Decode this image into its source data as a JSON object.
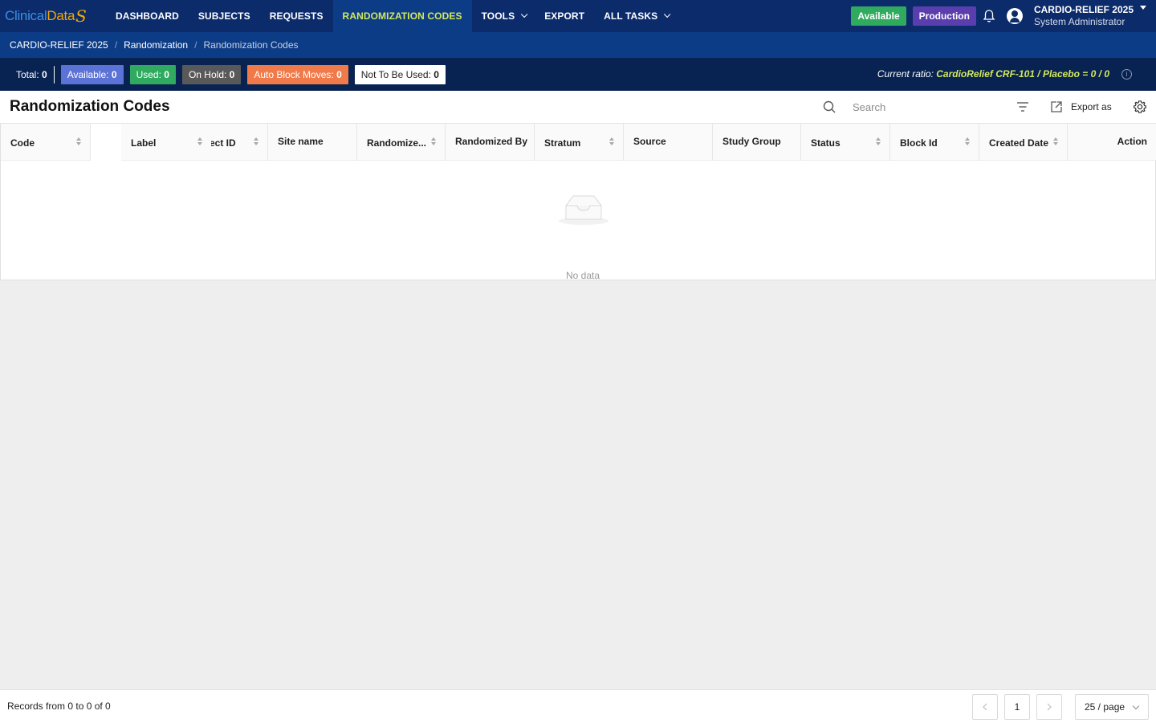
{
  "brand": {
    "part1": "Clinical",
    "part2": "Data",
    "mark": "S"
  },
  "nav": {
    "items": [
      {
        "label": "DASHBOARD"
      },
      {
        "label": "SUBJECTS"
      },
      {
        "label": "REQUESTS"
      },
      {
        "label": "RANDOMIZATION CODES",
        "active": true
      },
      {
        "label": "TOOLS",
        "dropdown": true
      },
      {
        "label": "EXPORT"
      },
      {
        "label": "ALL TASKS",
        "dropdown": true
      }
    ],
    "status_badge": "Available",
    "env_badge": "Production",
    "study_name": "CARDIO-RELIEF 2025",
    "user_role": "System Administrator"
  },
  "breadcrumb": [
    "CARDIO-RELIEF 2025",
    "Randomization",
    "Randomization Codes"
  ],
  "stats": {
    "total_label": "Total:",
    "total_value": "0",
    "available_label": "Available:",
    "available_value": "0",
    "used_label": "Used:",
    "used_value": "0",
    "hold_label": "On Hold:",
    "hold_value": "0",
    "auto_label": "Auto Block Moves:",
    "auto_value": "0",
    "notuse_label": "Not To Be Used:",
    "notuse_value": "0",
    "ratio_label": "Current ratio:",
    "ratio_value": "CardioRelief CRF-101 / Placebo = 0 / 0"
  },
  "page": {
    "title": "Randomization Codes",
    "search_placeholder": "Search",
    "export_label": "Export as"
  },
  "table": {
    "columns": [
      "Code",
      "Label",
      "ect ID",
      "Site name",
      "Randomize...",
      "Randomized By",
      "Stratum",
      "Source",
      "Study Group",
      "Status",
      "Block Id",
      "Created Date",
      "Action"
    ],
    "rows": [],
    "empty_text": "No data"
  },
  "footer": {
    "records_text": "Records from 0 to 0 of 0",
    "current_page": "1",
    "page_size": "25 / page"
  },
  "colors": {
    "nav_bg": "#0b2b6b",
    "crumb_bg": "#0d3c86",
    "stats_bg": "#082352",
    "accent": "#d4e85a",
    "available": "#5b72d6",
    "used": "#2faa5f",
    "hold": "#595959",
    "auto": "#f07a4a",
    "production": "#5a3eae"
  }
}
